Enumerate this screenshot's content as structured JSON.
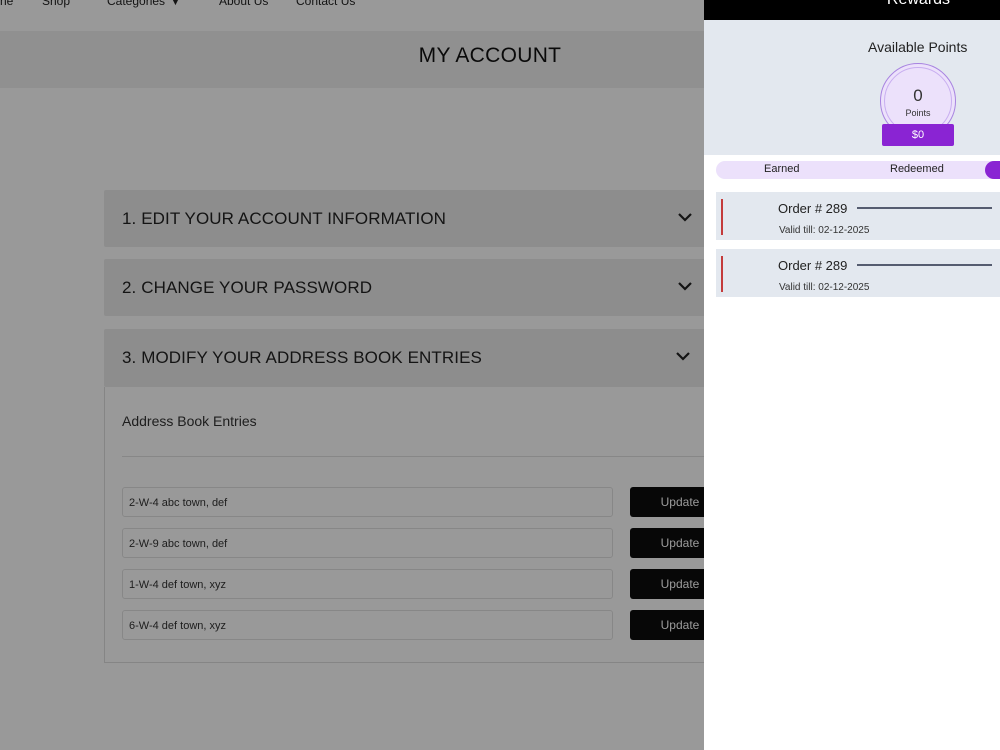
{
  "nav": {
    "items": [
      {
        "label": "ne"
      },
      {
        "label": "Shop"
      },
      {
        "label": "Categories"
      },
      {
        "label": "About Us"
      },
      {
        "label": "Contact Us"
      }
    ]
  },
  "account": {
    "title": "MY ACCOUNT",
    "panels": [
      {
        "label": "1.  EDIT YOUR ACCOUNT INFORMATION"
      },
      {
        "label": "2.  CHANGE YOUR PASSWORD"
      },
      {
        "label": "3.  MODIFY YOUR ADDRESS BOOK ENTRIES"
      }
    ],
    "address_book": {
      "heading": "Address Book Entries",
      "entries": [
        {
          "address": "2-W-4 abc town, def",
          "button": "Update"
        },
        {
          "address": "2-W-9 abc town, def",
          "button": "Update"
        },
        {
          "address": "1-W-4 def town, xyz",
          "button": "Update"
        },
        {
          "address": "6-W-4 def town, xyz",
          "button": "Update"
        }
      ]
    }
  },
  "rewards": {
    "title": "Rewards",
    "available_label": "Available Points",
    "points_value": "0",
    "points_unit": "Points",
    "points_dollar": "$0",
    "tabs": [
      {
        "label": "Earned"
      },
      {
        "label": "Redeemed"
      }
    ],
    "orders": [
      {
        "title": "Order # 289",
        "valid": "Valid till: 02-12-2025"
      },
      {
        "title": "Order # 289",
        "valid": "Valid till: 02-12-2025"
      }
    ]
  },
  "colors": {
    "accent_purple": "#8a24d3",
    "drawer_panel_bg": "#e3e8ef",
    "order_accent_red": "#c43b3b",
    "button_black": "#0d0d0d"
  }
}
